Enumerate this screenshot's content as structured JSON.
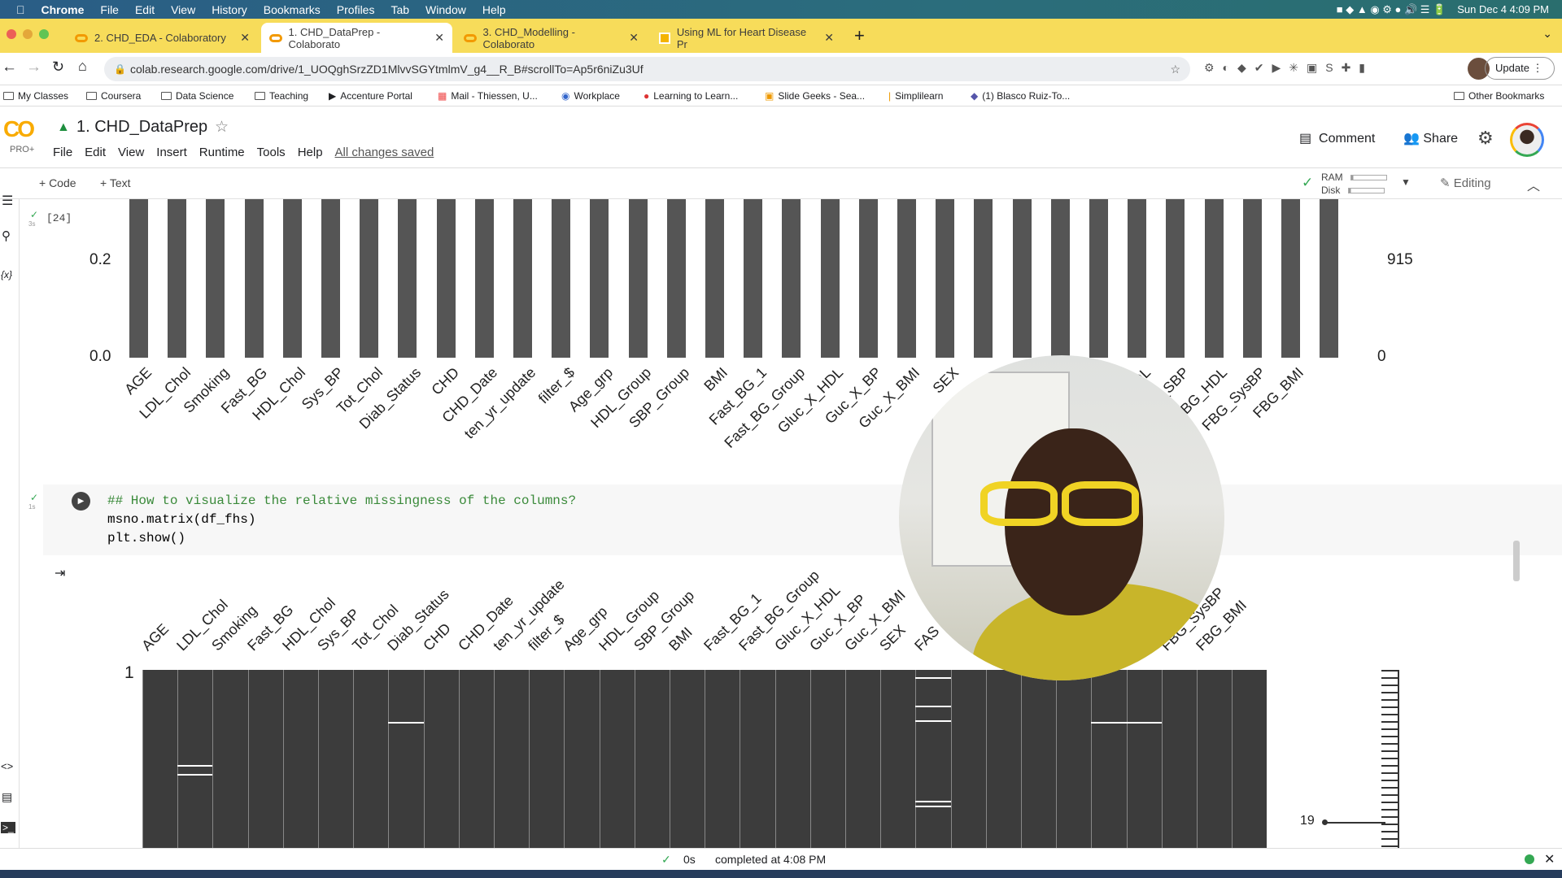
{
  "os_menu": {
    "app": "Chrome",
    "items": [
      "File",
      "Edit",
      "View",
      "History",
      "Bookmarks",
      "Profiles",
      "Tab",
      "Window",
      "Help"
    ],
    "clock": "Sun Dec 4  4:09 PM"
  },
  "tabs": [
    {
      "label": "2. CHD_EDA - Colaboratory"
    },
    {
      "label": "1. CHD_DataPrep - Colaborato"
    },
    {
      "label": "3. CHD_Modelling - Colaborato"
    },
    {
      "label": "Using ML for Heart Disease Pr"
    }
  ],
  "address": {
    "url": "colab.research.google.com/drive/1_UOQghSrzZD1MlvvSGYtmlmV_g4__R_B#scrollTo=Ap5r6niZu3Uf",
    "update_label": "Update"
  },
  "bookmarks": [
    "My Classes",
    "Coursera",
    "Data Science",
    "Teaching",
    "Accenture Portal",
    "Mail - Thiessen, U...",
    "Workplace",
    "Learning to Learn...",
    "Slide Geeks - Sea...",
    "Simplilearn",
    "(1) Blasco Ruiz-To..."
  ],
  "other_bookmarks": "Other Bookmarks",
  "colab": {
    "logo": "CO",
    "pro": "PRO+",
    "title": "1. CHD_DataPrep",
    "menu": [
      "File",
      "Edit",
      "View",
      "Insert",
      "Runtime",
      "Tools",
      "Help"
    ],
    "saved": "All changes saved",
    "comment": "Comment",
    "share": "Share"
  },
  "toolbar": {
    "code": "+ Code",
    "text": "+ Text",
    "ram": "RAM",
    "disk": "Disk",
    "editing": "Editing"
  },
  "cells": {
    "prev_exec": "[24]",
    "prev_time": "3s",
    "cur_time": "1s",
    "code": [
      "## How to visualize the relative missingness of the columns?",
      "msno.matrix(df_fhs)",
      "plt.show()"
    ]
  },
  "status": {
    "time": "0s",
    "text": "completed at 4:08 PM"
  },
  "chart_data": [
    {
      "type": "bar",
      "title": "",
      "left_ticks": [
        "0.0",
        "0.2"
      ],
      "right_ticks": [
        "0",
        "915"
      ],
      "ylim": [
        0,
        1
      ],
      "categories": [
        "AGE",
        "LDL_Chol",
        "Smoking",
        "Fast_BG",
        "HDL_Chol",
        "Sys_BP",
        "Tot_Chol",
        "Diab_Status",
        "CHD",
        "CHD_Date",
        "ten_yr_update",
        "filter_$",
        "Age_grp",
        "HDL_Group",
        "SBP_Group",
        "BMI",
        "Fast_BG_1",
        "Fast_BG_Group",
        "Gluc_X_HDL",
        "Guc_X_BP",
        "Guc_X_BMI",
        "SEX",
        "",
        "",
        "",
        "",
        "HDL",
        "_x_SBP",
        "FBG_HDL",
        "FBG_SysBP",
        "FBG_BMI",
        ""
      ],
      "values": [
        1,
        1,
        1,
        1,
        1,
        1,
        1,
        1,
        1,
        1,
        1,
        1,
        1,
        1,
        1,
        1,
        1,
        1,
        1,
        1,
        1,
        1,
        1,
        1,
        1,
        1,
        1,
        1,
        1,
        1,
        1,
        1
      ],
      "bar_color": "#555555"
    },
    {
      "type": "heatmap",
      "subtype": "missingness-matrix",
      "row_start_label": "1",
      "sparkline_label": "19",
      "columns": [
        "AGE",
        "LDL_Chol",
        "Smoking",
        "Fast_BG",
        "HDL_Chol",
        "Sys_BP",
        "Tot_Chol",
        "Diab_Status",
        "CHD",
        "CHD_Date",
        "ten_yr_update",
        "filter_$",
        "Age_grp",
        "HDL_Group",
        "SBP_Group",
        "BMI",
        "Fast_BG_1",
        "Fast_BG_Group",
        "Gluc_X_HDL",
        "Guc_X_BP",
        "Guc_X_BMI",
        "SEX",
        "FAS",
        "",
        "",
        "",
        "",
        "Diab_x_SBP",
        "FBG_HDL",
        "FBG_SysBP",
        "FBG_BMI",
        ""
      ],
      "missing_rows_fraction": {
        "1": [
          0.53,
          0.58
        ],
        "7": [
          0.29
        ],
        "22": [
          0.04,
          0.2,
          0.28,
          0.73,
          0.76
        ],
        "27": [
          0.29
        ],
        "28": [
          0.29
        ]
      },
      "filled_color": "#3c3c3c"
    }
  ]
}
